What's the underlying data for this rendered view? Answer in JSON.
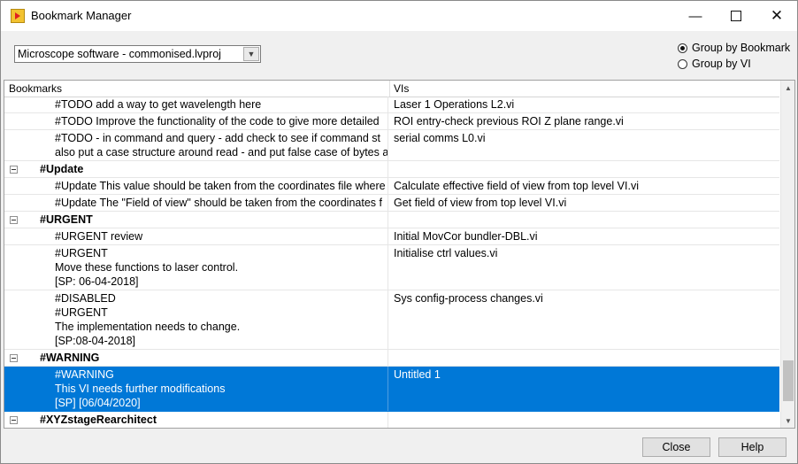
{
  "window": {
    "title": "Bookmark Manager"
  },
  "project": {
    "selected": "Microscope software - commonised.lvproj"
  },
  "grouping": {
    "by_bookmark": "Group by Bookmark",
    "by_vi": "Group by VI",
    "selected": "Group by Bookmark"
  },
  "columns": {
    "bookmarks": "Bookmarks",
    "vis": "VIs"
  },
  "rows": [
    {
      "kind": "item",
      "lines": [
        "#TODO add a way to get wavelength here"
      ],
      "vi": "Laser 1 Operations L2.vi"
    },
    {
      "kind": "item",
      "lines": [
        "#TODO  Improve the functionality of the code to give more detailed"
      ],
      "vi": "ROI entry-check previous ROI Z plane range.vi"
    },
    {
      "kind": "item",
      "lines": [
        "#TODO - in command and query - add check to see if command st",
        "also put a case structure around read - and put false case of bytes a"
      ],
      "vi": "serial comms L0.vi"
    },
    {
      "kind": "group",
      "lines": [
        "#Update"
      ],
      "vi": ""
    },
    {
      "kind": "item",
      "lines": [
        "#Update This value should be taken from the coordinates file where"
      ],
      "vi": "Calculate effective field of view from top level VI.vi"
    },
    {
      "kind": "item",
      "lines": [
        "#Update The \"Field of view\" should be taken from the coordinates f"
      ],
      "vi": "Get field of view from top level VI.vi"
    },
    {
      "kind": "group",
      "lines": [
        "#URGENT"
      ],
      "vi": ""
    },
    {
      "kind": "item",
      "lines": [
        "#URGENT review"
      ],
      "vi": "Initial MovCor bundler-DBL.vi"
    },
    {
      "kind": "item",
      "lines": [
        "#URGENT",
        "Move these functions to laser control.",
        "[SP: 06-04-2018]"
      ],
      "vi": "Initialise ctrl values.vi"
    },
    {
      "kind": "item",
      "lines": [
        "#DISABLED",
        "#URGENT",
        "The implementation needs to change.",
        "[SP:08-04-2018]"
      ],
      "vi": "Sys config-process changes.vi"
    },
    {
      "kind": "group",
      "lines": [
        "#WARNING"
      ],
      "vi": ""
    },
    {
      "kind": "item",
      "selected": true,
      "lines": [
        "#WARNING",
        "This VI needs further modifications",
        "[SP] [06/04/2020]"
      ],
      "vi": "Untitled 1"
    },
    {
      "kind": "group",
      "lines": [
        "#XYZstageRearchitect"
      ],
      "vi": ""
    }
  ],
  "buttons": {
    "close": "Close",
    "help": "Help"
  },
  "colors": {
    "selection": "#0078d7"
  },
  "icons": {
    "app": "labview-app-icon",
    "minimize": "minimize-icon",
    "maximize": "maximize-icon",
    "close": "close-icon",
    "collapse": "collapse-toggle-icon",
    "dropdown": "chevron-down-icon"
  }
}
